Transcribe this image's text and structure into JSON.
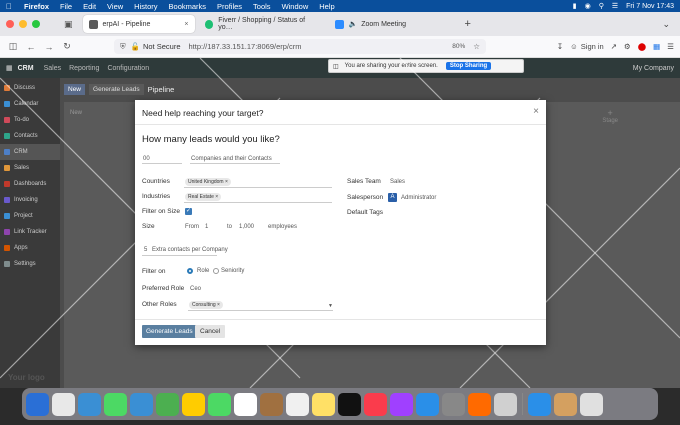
{
  "menubar": {
    "app": "Firefox",
    "items": [
      "File",
      "Edit",
      "View",
      "History",
      "Bookmarks",
      "Profiles",
      "Tools",
      "Window",
      "Help"
    ],
    "clock": "Fri 7 Nov  17:43"
  },
  "tabs": [
    {
      "title": "erpAI - Pipeline",
      "color": "#5b5b5b"
    },
    {
      "title": "Fiverr / Shopping / Status of yo…",
      "color": "#1dbf73"
    },
    {
      "title": "Zoom Meeting",
      "color": "#2d8cff"
    }
  ],
  "address": {
    "security": "Not Secure",
    "url": "http://187.33.151.17:8069/erp/crm",
    "zoom": "80%",
    "signin": "Sign in"
  },
  "odoo": {
    "brand": "CRM",
    "nav": [
      "Sales",
      "Reporting",
      "Configuration"
    ],
    "company": "My Company",
    "sidebar": [
      "Discuss",
      "Calendar",
      "To-do",
      "Contacts",
      "CRM",
      "Sales",
      "Dashboards",
      "Invoicing",
      "Project",
      "Link Tracker",
      "Apps",
      "Settings"
    ],
    "sidebar_colors": [
      "#e07b39",
      "#3a8fd4",
      "#d04a5a",
      "#2ea58a",
      "#4d7fc7",
      "#e0973a",
      "#c0392b",
      "#6a5acd",
      "#3a8fd4",
      "#8e44ad",
      "#d35400",
      "#7f8c8d"
    ],
    "logo_text": "Your logo",
    "new_btn": "New",
    "gen_btn": "Generate Leads",
    "pipeline": "Pipeline",
    "column": "New",
    "add_stage": "Stage"
  },
  "sharebar": {
    "text": "You are sharing your entire screen.",
    "stop": "Stop Sharing"
  },
  "modal": {
    "title": "Need help reaching your target?",
    "heading": "How many leads would you like?",
    "count": "00",
    "count_desc": "Companies and their Contacts",
    "countries_label": "Countries",
    "country_tag": "United Kingdom",
    "industries_label": "Industries",
    "industry_tag": "Real Estate",
    "filter_size_label": "Filter on Size",
    "size_label": "Size",
    "size_from_word": "From",
    "size_from": "1",
    "size_to_word": "to",
    "size_to": "1,000",
    "size_unit": "employees",
    "extra_count": "5",
    "extra_label": "Extra contacts per Company",
    "filter_on_label": "Filter on",
    "opt_role": "Role",
    "opt_seniority": "Seniority",
    "pref_role_label": "Preferred Role",
    "pref_role": "Ceo",
    "other_roles_label": "Other Roles",
    "other_role_tag": "Consulting",
    "sales_team_label": "Sales Team",
    "sales_team": "Sales",
    "salesperson_label": "Salesperson",
    "salesperson_initial": "A",
    "salesperson": "Administrator",
    "default_tags_label": "Default Tags",
    "generate": "Generate Leads",
    "cancel": "Cancel"
  },
  "dock_colors": [
    "#2a6fd6",
    "#e8e8e8",
    "#3a8fd4",
    "#4cd964",
    "#3a8fd4",
    "#4caf50",
    "#ffcc00",
    "#4cd964",
    "#ffffff",
    "#a07040",
    "#f0f0f0",
    "#ffe066",
    "#111111",
    "#fa3c4c",
    "#a040ff",
    "#2a8fe8",
    "#888888",
    "#ff6a00",
    "#d0d0d0",
    "#2a8fe8",
    "#d4a060",
    "#e0e0e0"
  ]
}
